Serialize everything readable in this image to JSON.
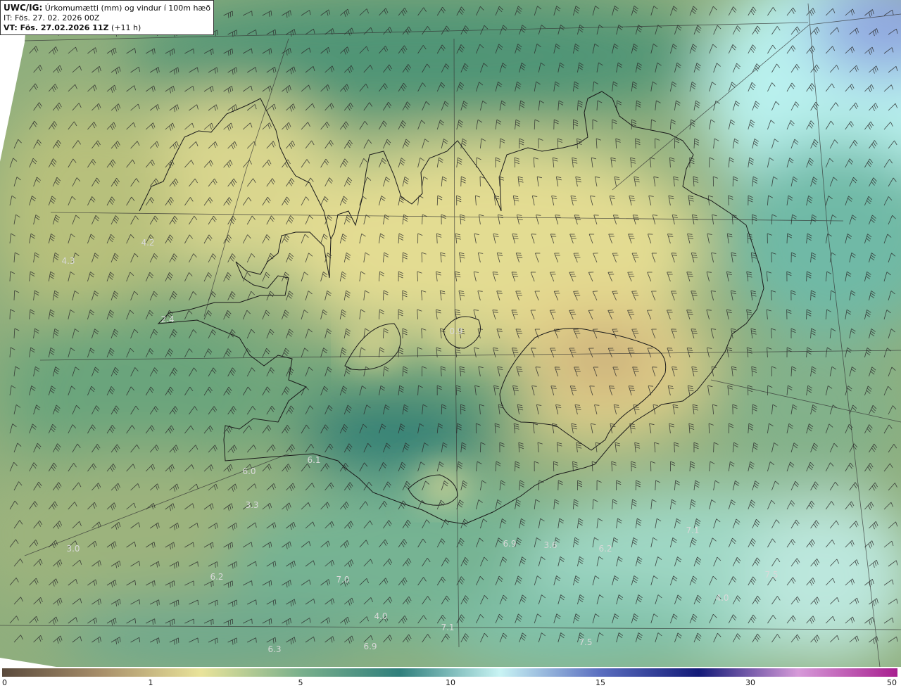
{
  "header": {
    "model": "UWC/IG:",
    "title": "Úrkomumætti (mm) og vindur í 100m hæð",
    "init_time": "IT: Fös. 27. 02. 2026 00Z",
    "valid_prefix": "VT: Fös. 27.02.2026 11Z",
    "valid_suffix": "(+11 h)"
  },
  "value_labels": [
    "4.3",
    "4.2",
    "2.4",
    "6.0",
    "6.1",
    "3.3",
    "3.0",
    "6.2",
    "7.0",
    "4.0",
    "6.9",
    "6.3",
    "7.1",
    "6.9",
    "3.6",
    "6.2",
    "7.1",
    "7.5",
    "4.0",
    "7.5",
    "0.9"
  ],
  "colorbar": {
    "ticks": [
      "0",
      "1",
      "5",
      "10",
      "15",
      "30",
      "50"
    ],
    "colors": [
      "#5a4a3c",
      "#a88f6a",
      "#e9e39a",
      "#7ab08c",
      "#2f7f7c",
      "#c9f4f4",
      "#5b6fc0",
      "#131a78",
      "#d69ad9",
      "#a81f8f"
    ]
  },
  "colors": {
    "land_light": "#e8e094",
    "land_mid": "#b7c27e",
    "sea_green": "#5f9f76",
    "sea_teal": "#2e7f74",
    "cyan": "#b9f1ee",
    "blue": "#8fa6e0"
  }
}
